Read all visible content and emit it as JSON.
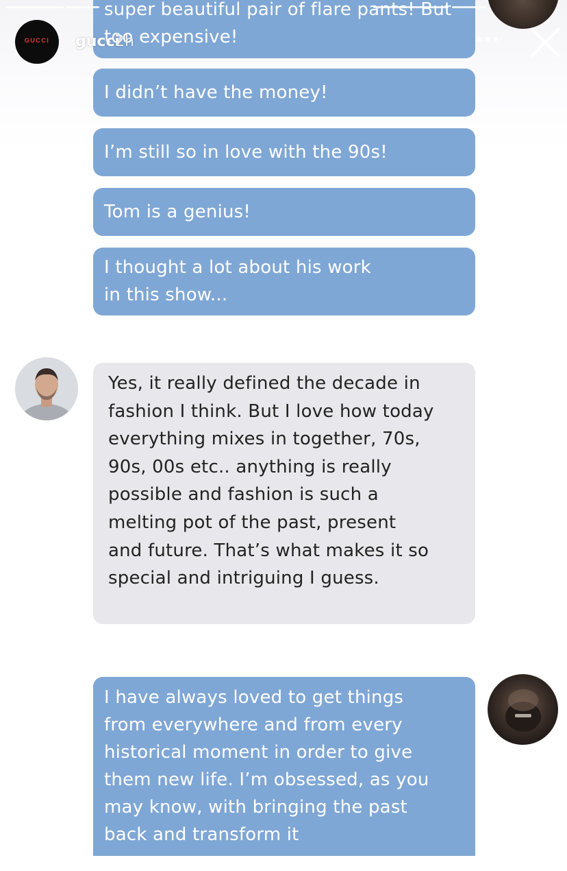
{
  "story_header": {
    "account_logo_text": "GUCCI",
    "username": "gucci",
    "time_ago": "2h",
    "more_label": "···",
    "close_icon": "close-icon"
  },
  "chat": {
    "messages": [
      {
        "sender": "right",
        "text": "super beautiful pair of flare pants! But too expensive!"
      },
      {
        "sender": "right",
        "text": "I didn’t have the money!"
      },
      {
        "sender": "right",
        "text": "I’m still so in love with the 90s!"
      },
      {
        "sender": "right",
        "text": "Tom is a genius!"
      },
      {
        "sender": "right",
        "text": "I thought a lot about his work in this show..."
      },
      {
        "sender": "left",
        "text": "Yes, it really defined the decade in fashion I think. But I love how today everything mixes in together, 70s, 90s, 00s etc.. anything is really possible and fashion is such a melting pot of the past, present and future. That’s what makes it so special and intriguing I guess."
      },
      {
        "sender": "right",
        "text": "I have always loved to get things from everywhere and from every historical moment in order to give them new life. I’m obsessed, as you may know, with bringing the past back and transform it"
      }
    ]
  },
  "colors": {
    "blue_bubble": "#7fa7d5",
    "gray_bubble": "#e8e8ec",
    "text_dark": "#222222"
  }
}
